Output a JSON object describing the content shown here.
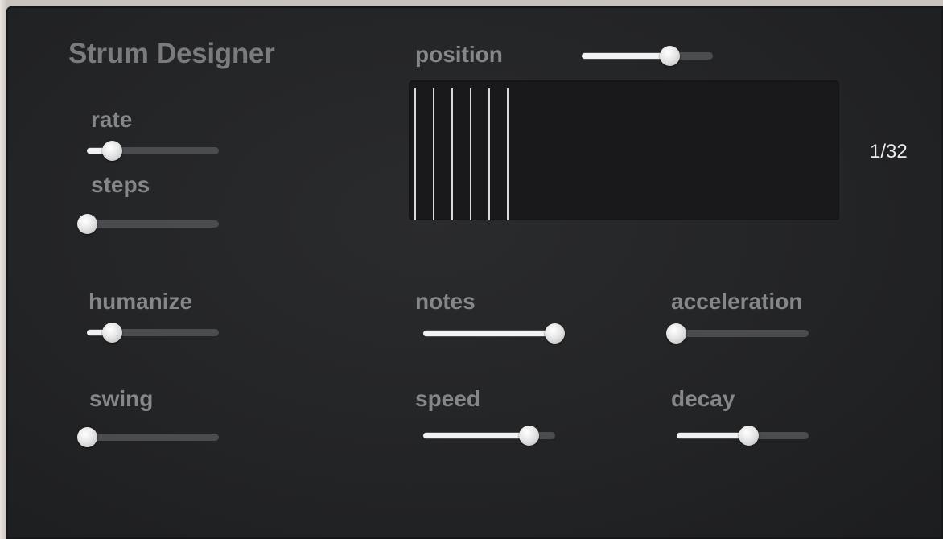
{
  "panel": {
    "title": "Strum Designer",
    "rate_value_display": "1/32"
  },
  "display": {
    "strum_line_count": 6,
    "line_color": "#d8d8d8"
  },
  "colors": {
    "panel_bg": "#232426",
    "label_text": "#86878a",
    "track": "#4b4c4f",
    "track_fill": "#f2f2f2",
    "thumb": "#e6e6e6"
  },
  "controls": {
    "position": {
      "label": "position",
      "value_fraction": 0.67
    },
    "rate": {
      "label": "rate",
      "value_fraction": 0.19
    },
    "steps": {
      "label": "steps",
      "value_fraction": 0.0
    },
    "humanize": {
      "label": "humanize",
      "value_fraction": 0.19
    },
    "swing": {
      "label": "swing",
      "value_fraction": 0.0
    },
    "notes": {
      "label": "notes",
      "value_fraction": 1.0
    },
    "speed": {
      "label": "speed",
      "value_fraction": 0.8
    },
    "acceleration": {
      "label": "acceleration",
      "value_fraction": 0.0
    },
    "decay": {
      "label": "decay",
      "value_fraction": 0.54
    }
  }
}
